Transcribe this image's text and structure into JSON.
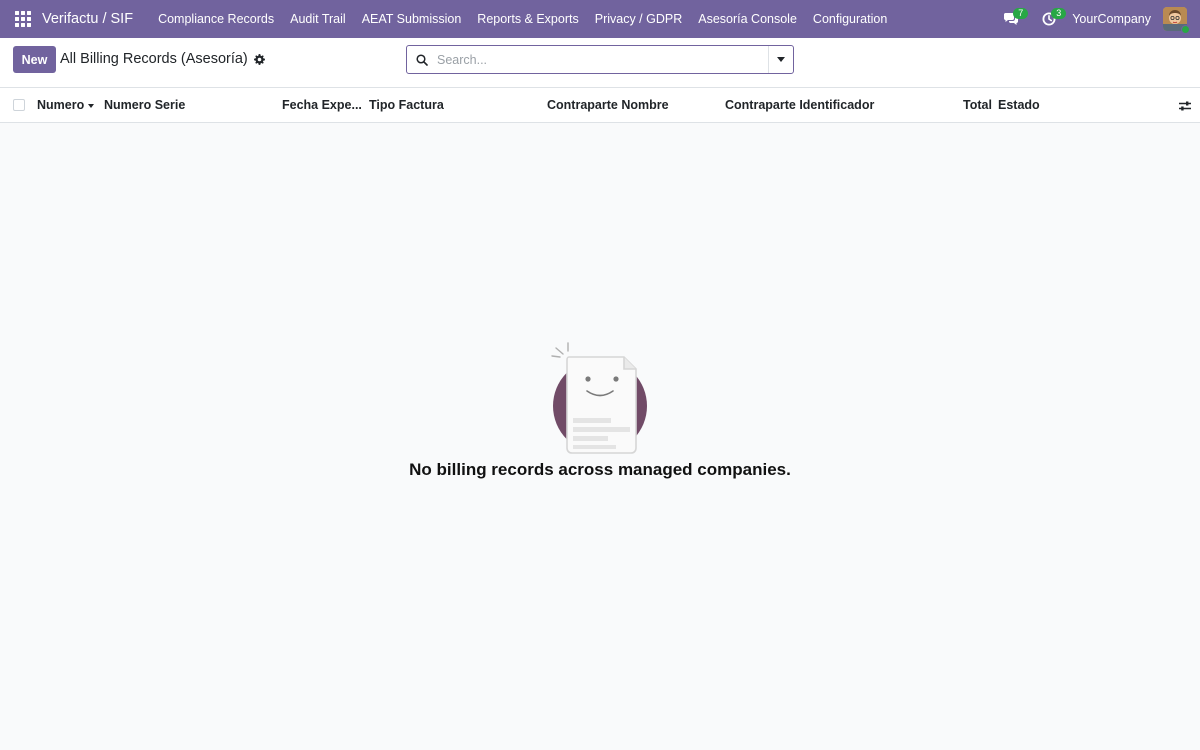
{
  "navbar": {
    "brand": "Verifactu / SIF",
    "menu": [
      {
        "label": "Compliance Records"
      },
      {
        "label": "Audit Trail"
      },
      {
        "label": "AEAT Submission"
      },
      {
        "label": "Reports & Exports"
      },
      {
        "label": "Privacy / GDPR"
      },
      {
        "label": "Asesoría Console"
      },
      {
        "label": "Configuration"
      }
    ],
    "messages_count": "7",
    "activities_count": "3",
    "company": "YourCompany"
  },
  "control_panel": {
    "new_label": "New",
    "breadcrumb": "All Billing Records (Asesoría)",
    "search_placeholder": "Search..."
  },
  "list": {
    "columns": [
      {
        "label": "Numero"
      },
      {
        "label": "Numero Serie"
      },
      {
        "label": "Fecha Expe..."
      },
      {
        "label": "Tipo Factura"
      },
      {
        "label": "Contraparte Nombre"
      },
      {
        "label": "Contraparte Identificador"
      },
      {
        "label": "Total"
      },
      {
        "label": "Estado"
      }
    ]
  },
  "empty_state": {
    "title": "No billing records across managed companies."
  },
  "colors": {
    "brand": "#71639e",
    "badge": "#28a745",
    "illustration_circle": "#714b67"
  },
  "icons": [
    "apps-grid-icon",
    "chat-icon",
    "clock-icon",
    "gear-icon",
    "search-icon",
    "chevron-down-icon",
    "sliders-icon"
  ]
}
